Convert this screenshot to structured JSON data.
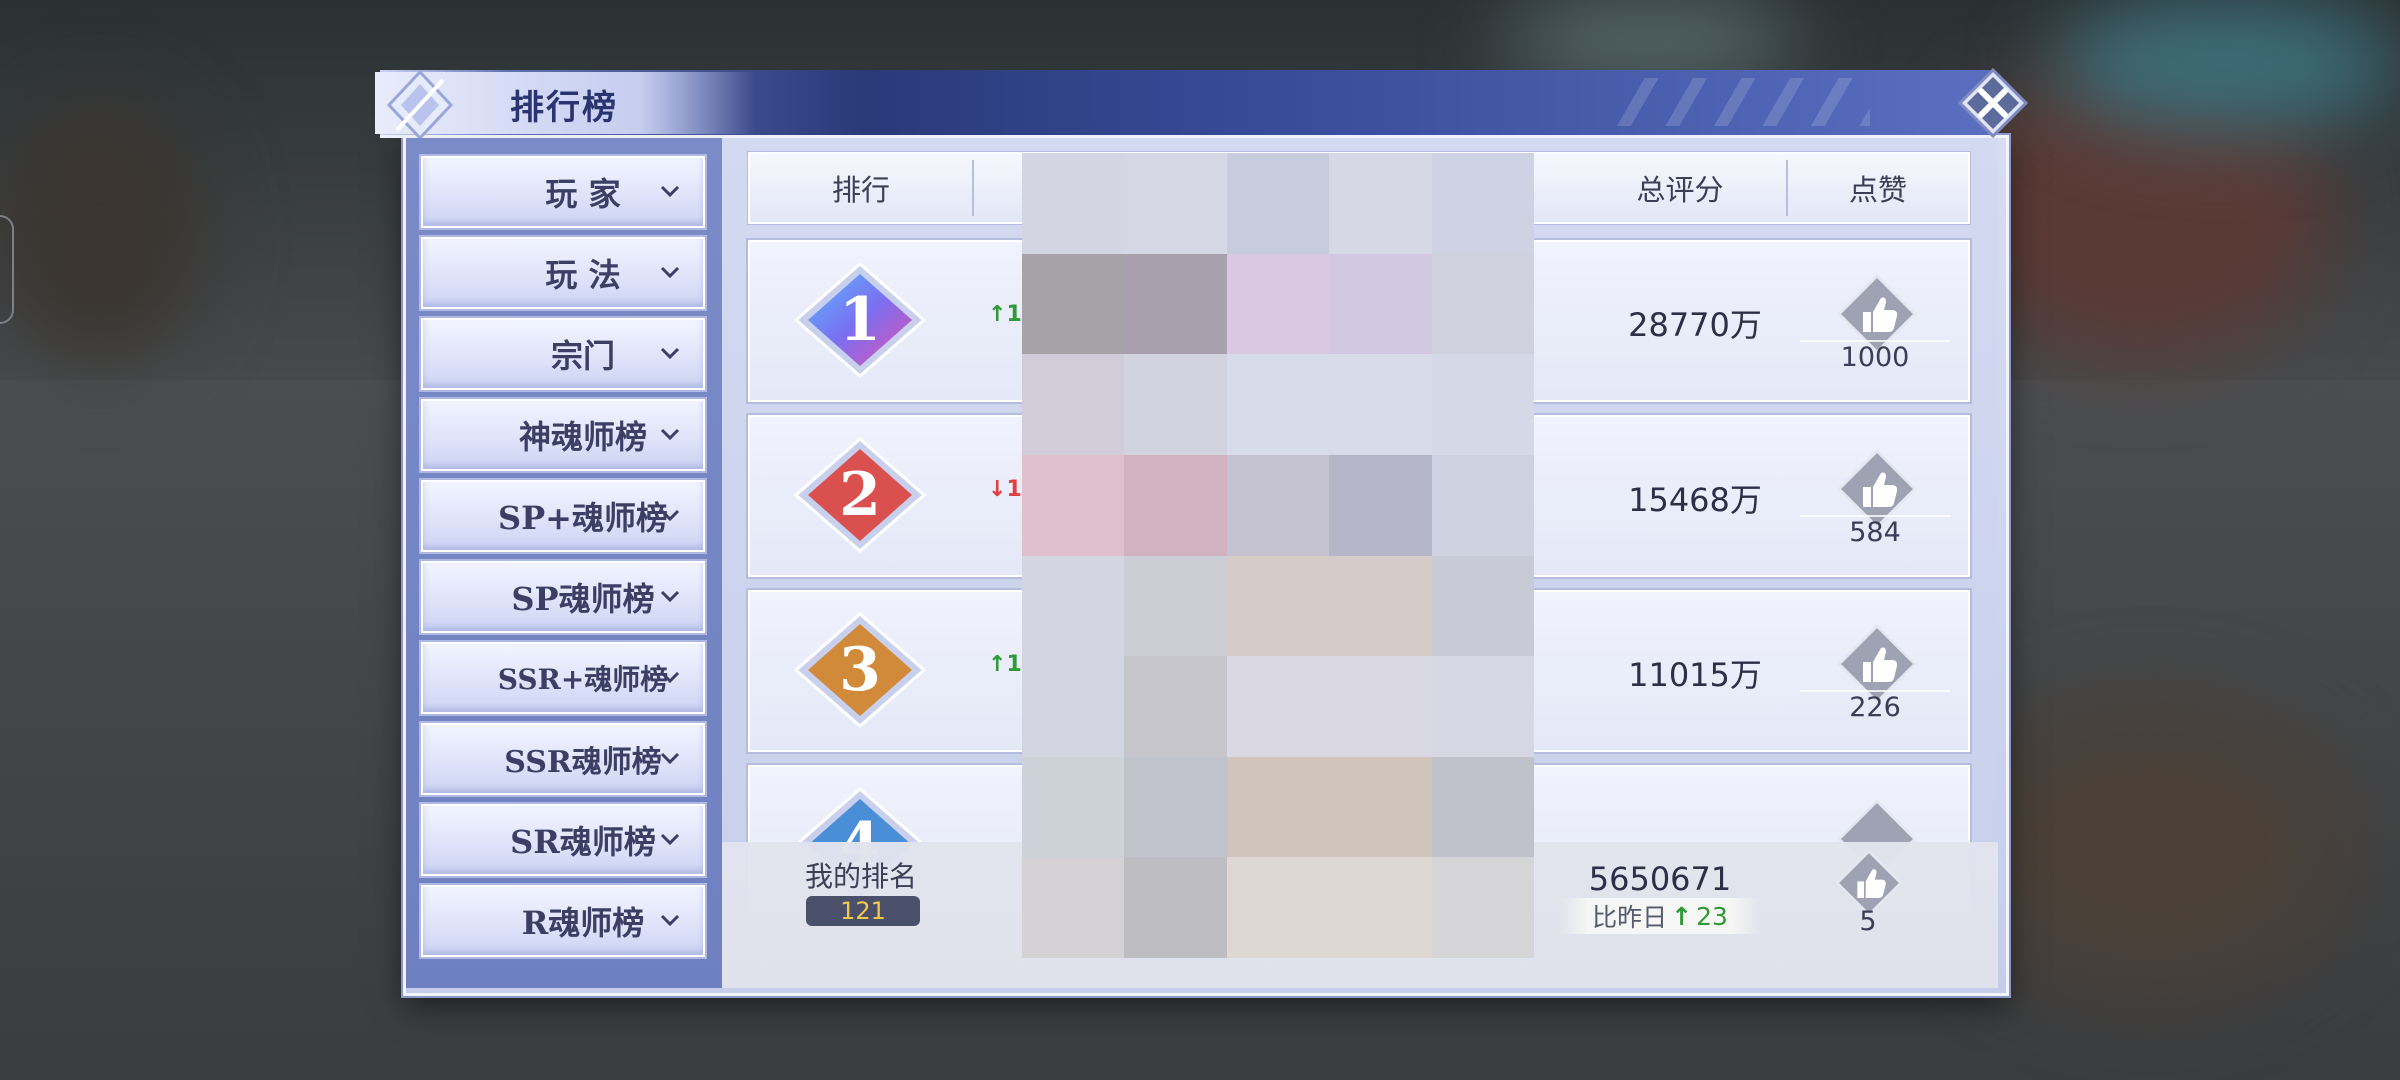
{
  "window": {
    "title": "排行榜"
  },
  "nav": {
    "items": [
      {
        "label": "玩 家"
      },
      {
        "label": "玩 法"
      },
      {
        "label": "宗门"
      },
      {
        "label": "神魂师榜"
      },
      {
        "label": "SP+魂师榜"
      },
      {
        "label": "SP魂师榜"
      },
      {
        "label": "SSR+魂师榜"
      },
      {
        "label": "SSR魂师榜"
      },
      {
        "label": "SR魂师榜"
      },
      {
        "label": "R魂师榜"
      }
    ]
  },
  "table": {
    "headers": {
      "rank": "排行",
      "score": "总评分",
      "likes": "点赞"
    },
    "rows": [
      {
        "rank": "1",
        "trend": "up",
        "trend_text": "1",
        "score": "28770万",
        "likes": "1000",
        "gem_color": "#7a6ff0"
      },
      {
        "rank": "2",
        "trend": "down",
        "trend_text": "1",
        "score": "15468万",
        "likes": "584",
        "gem_color": "#d9504f"
      },
      {
        "rank": "3",
        "trend": "up",
        "trend_text": "1",
        "score": "11015万",
        "likes": "226",
        "gem_color": "#d08a3a"
      },
      {
        "rank": "4",
        "trend": "",
        "trend_text": "",
        "score": "",
        "likes": "",
        "gem_color": "#4a8ed8"
      }
    ]
  },
  "my_rank": {
    "label": "我的排名",
    "rank": "121",
    "score": "5650671",
    "compare_label": "比昨日",
    "compare_value": "23",
    "likes": "5"
  },
  "colors": {
    "trend_up": "#2f9a37",
    "trend_down": "#e04040",
    "nav_bg": "#7b8bc8",
    "accent_dark": "#2a3978"
  },
  "mosaic": [
    "#d3d5e3",
    "#d5d7e4",
    "#c8cbdb",
    "#d6d8e6",
    "#cfd2e2",
    "#a5a3a7",
    "#a9a0ae",
    "#d8c8e0",
    "#d2c8e2",
    "#d0d1de",
    "#d0cdd8",
    "#d2d3df",
    "#d7dbea",
    "#d7dbea",
    "#d5d8e6",
    "#e0c0cc",
    "#d0b2c0",
    "#c5c3d0",
    "#b5b7c8",
    "#cdd1e0",
    "#d3d5e0",
    "#cdcdd6",
    "#d5ccc7",
    "#d5ccc7",
    "#c8cad6",
    "#d2d4df",
    "#c5c5cb",
    "#dad9e3",
    "#dad9e3",
    "#d6d7e2",
    "#cdd2d9",
    "#c0c3cb",
    "#d0c5bd",
    "#d0c5bd",
    "#c0c2cb",
    "#d5d2d5",
    "#bdbdc2",
    "#ddd8d2",
    "#ddd8d2",
    "#d5d5d8"
  ]
}
